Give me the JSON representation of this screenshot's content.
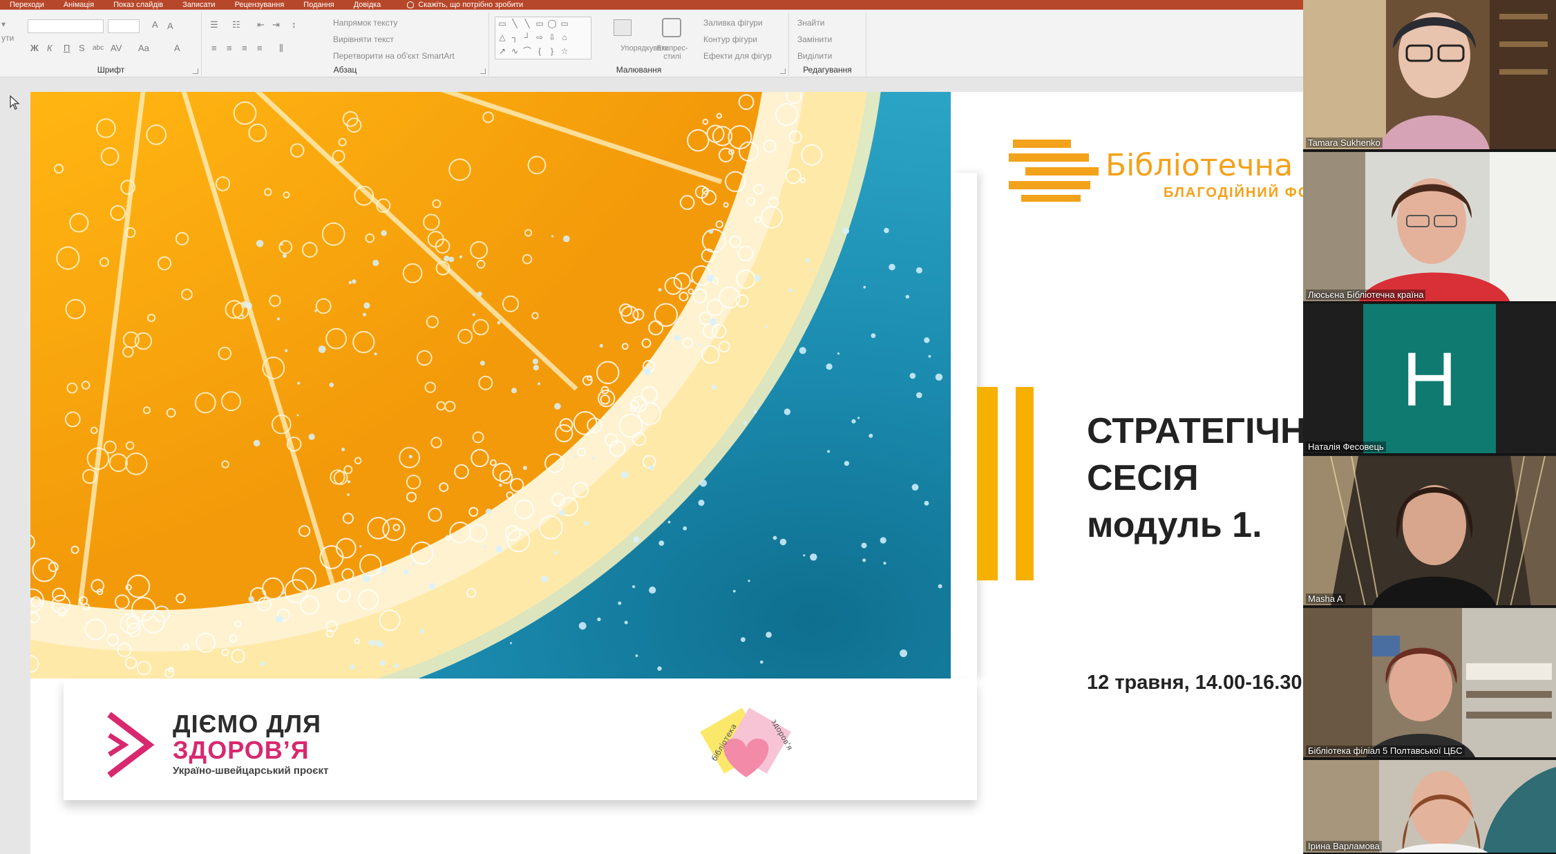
{
  "ppt": {
    "tabs": [
      "Переходи",
      "Анімація",
      "Показ слайдів",
      "Записати",
      "Рецензування",
      "Подання",
      "Довідка"
    ],
    "tell_me": "Скажіть, що потрібно зробити",
    "ribbon": {
      "left_fragment": "ути",
      "font_group_label": "Шрифт",
      "paragraph_group_label": "Абзац",
      "drawing_group_label": "Малювання",
      "editing_group_label": "Редагування",
      "text_direction": "Напрямок тексту",
      "align_text": "Вирівняти текст",
      "smartart": "Перетворити на об'єкт SmartArt",
      "arrange": "Упорядкувати",
      "quick_styles": "Експрес-стилі",
      "shape_fill": "Заливка фігури",
      "shape_outline": "Контур фігури",
      "shape_effects": "Ефекти для фігур",
      "find": "Знайти",
      "replace": "Замінити",
      "select": "Виділити"
    }
  },
  "slide": {
    "brand_name": "Бібліотечна Кр",
    "brand_sub": "БЛАГОДІЙНИЙ ФОНД",
    "title_lines": [
      "СТРАТЕГІЧН",
      "СЕСІЯ",
      "модуль 1."
    ],
    "date": "12 травня, 14.00-16.30",
    "project_line1": "ДІЄМО ДЛЯ",
    "project_line2": "ЗДОРОВ’Я",
    "project_line3": "Україно-швейцарський проєкт",
    "lib_logo_word1": "бібліотека",
    "lib_logo_word2": "здоров'я"
  },
  "participants": [
    {
      "name": "Tamara Sukhenko",
      "type": "video"
    },
    {
      "name": "Люсьєна Бібліотечна країна",
      "type": "video"
    },
    {
      "name": "Наталія Фесовець",
      "type": "avatar",
      "initial": "Н"
    },
    {
      "name": "Masha A",
      "type": "video"
    },
    {
      "name": "Бібліотека філіал 5 Полтавської ЦБС",
      "type": "video"
    },
    {
      "name": "Ірина Варламова",
      "type": "video"
    }
  ],
  "colors": {
    "ppt_accent": "#b7472a",
    "brand_orange": "#f3a21b",
    "bar_yellow": "#f6b100",
    "project_pink": "#d8286e",
    "avatar_teal": "#0f7a70"
  }
}
